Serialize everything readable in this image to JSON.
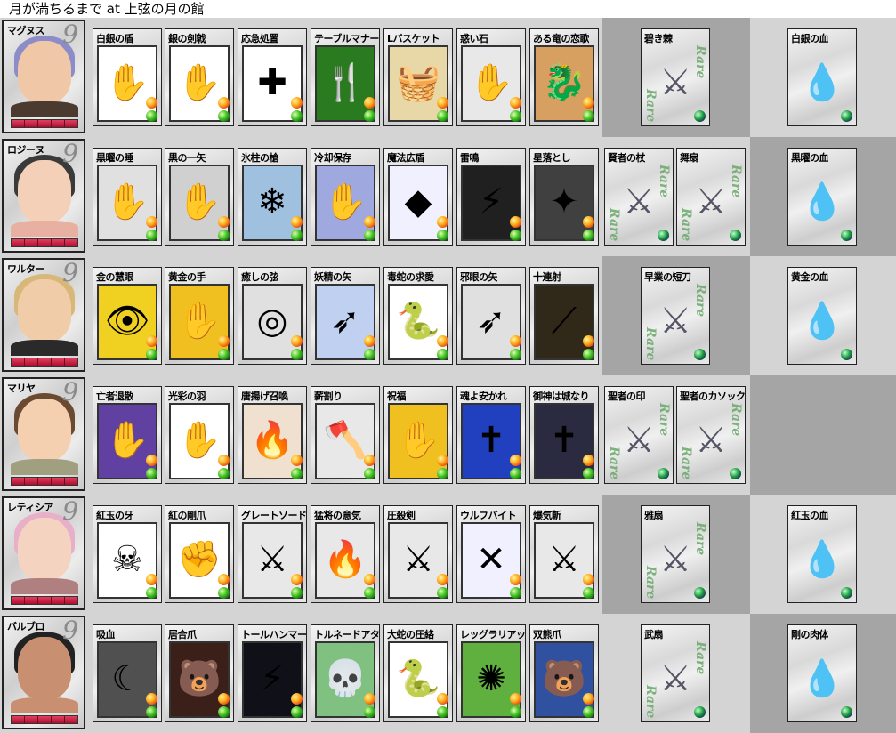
{
  "title": "月が満ちるまで at 上弦の月の館",
  "colors": {
    "row_light": "#d4d4d4",
    "row_dark": "#a5a5a5",
    "hp_bar": "#c8143c",
    "rare_text": "#6aa86a"
  },
  "rare_label": "Rare",
  "characters": [
    {
      "name": "マグヌス",
      "level": "9",
      "skills": [
        "白銀の盾",
        "銀の剣戟",
        "応急処置",
        "テーブルマナー",
        "Lバスケット",
        "惑い石",
        "ある竜の恋歌"
      ],
      "rare_items": [
        "碧き棘"
      ],
      "blood": "白銀の血"
    },
    {
      "name": "ロジーヌ",
      "level": "9",
      "skills": [
        "黒曜の睡",
        "黒の一矢",
        "氷柱の槍",
        "冷却保存",
        "魔法広盾",
        "雷鳴",
        "星落とし"
      ],
      "rare_items": [
        "賢者の杖",
        "舞扇"
      ],
      "blood": "黒曜の血"
    },
    {
      "name": "ワルター",
      "level": "9",
      "skills": [
        "金の慧眼",
        "黄金の手",
        "癒しの弦",
        "妖精の矢",
        "毒蛇の求愛",
        "邪眼の矢",
        "十連射"
      ],
      "rare_items": [
        "早業の短刀"
      ],
      "blood": "黄金の血"
    },
    {
      "name": "マリヤ",
      "level": "9",
      "skills": [
        "亡者退散",
        "光彩の羽",
        "唐揚げ召喚",
        "薪割り",
        "祝福",
        "魂よ安かれ",
        "御神は城なり"
      ],
      "rare_items": [
        "聖者の印",
        "聖者のカソック"
      ],
      "blood": ""
    },
    {
      "name": "レティシア",
      "level": "9",
      "skills": [
        "紅玉の牙",
        "紅の剛爪",
        "グレートソード",
        "猛将の意気",
        "圧殺剣",
        "ウルフバイト",
        "爆気斬"
      ],
      "rare_items": [
        "雅扇"
      ],
      "blood": "紅玉の血"
    },
    {
      "name": "バルブロ",
      "level": "9",
      "skills": [
        "吸血",
        "居合爪",
        "トールハンマー",
        "トルネードアタック",
        "大蛇の圧絡",
        "レッグラリアット",
        "双熊爪"
      ],
      "rare_items": [
        "武扇"
      ],
      "blood": "剛の肉体"
    }
  ]
}
